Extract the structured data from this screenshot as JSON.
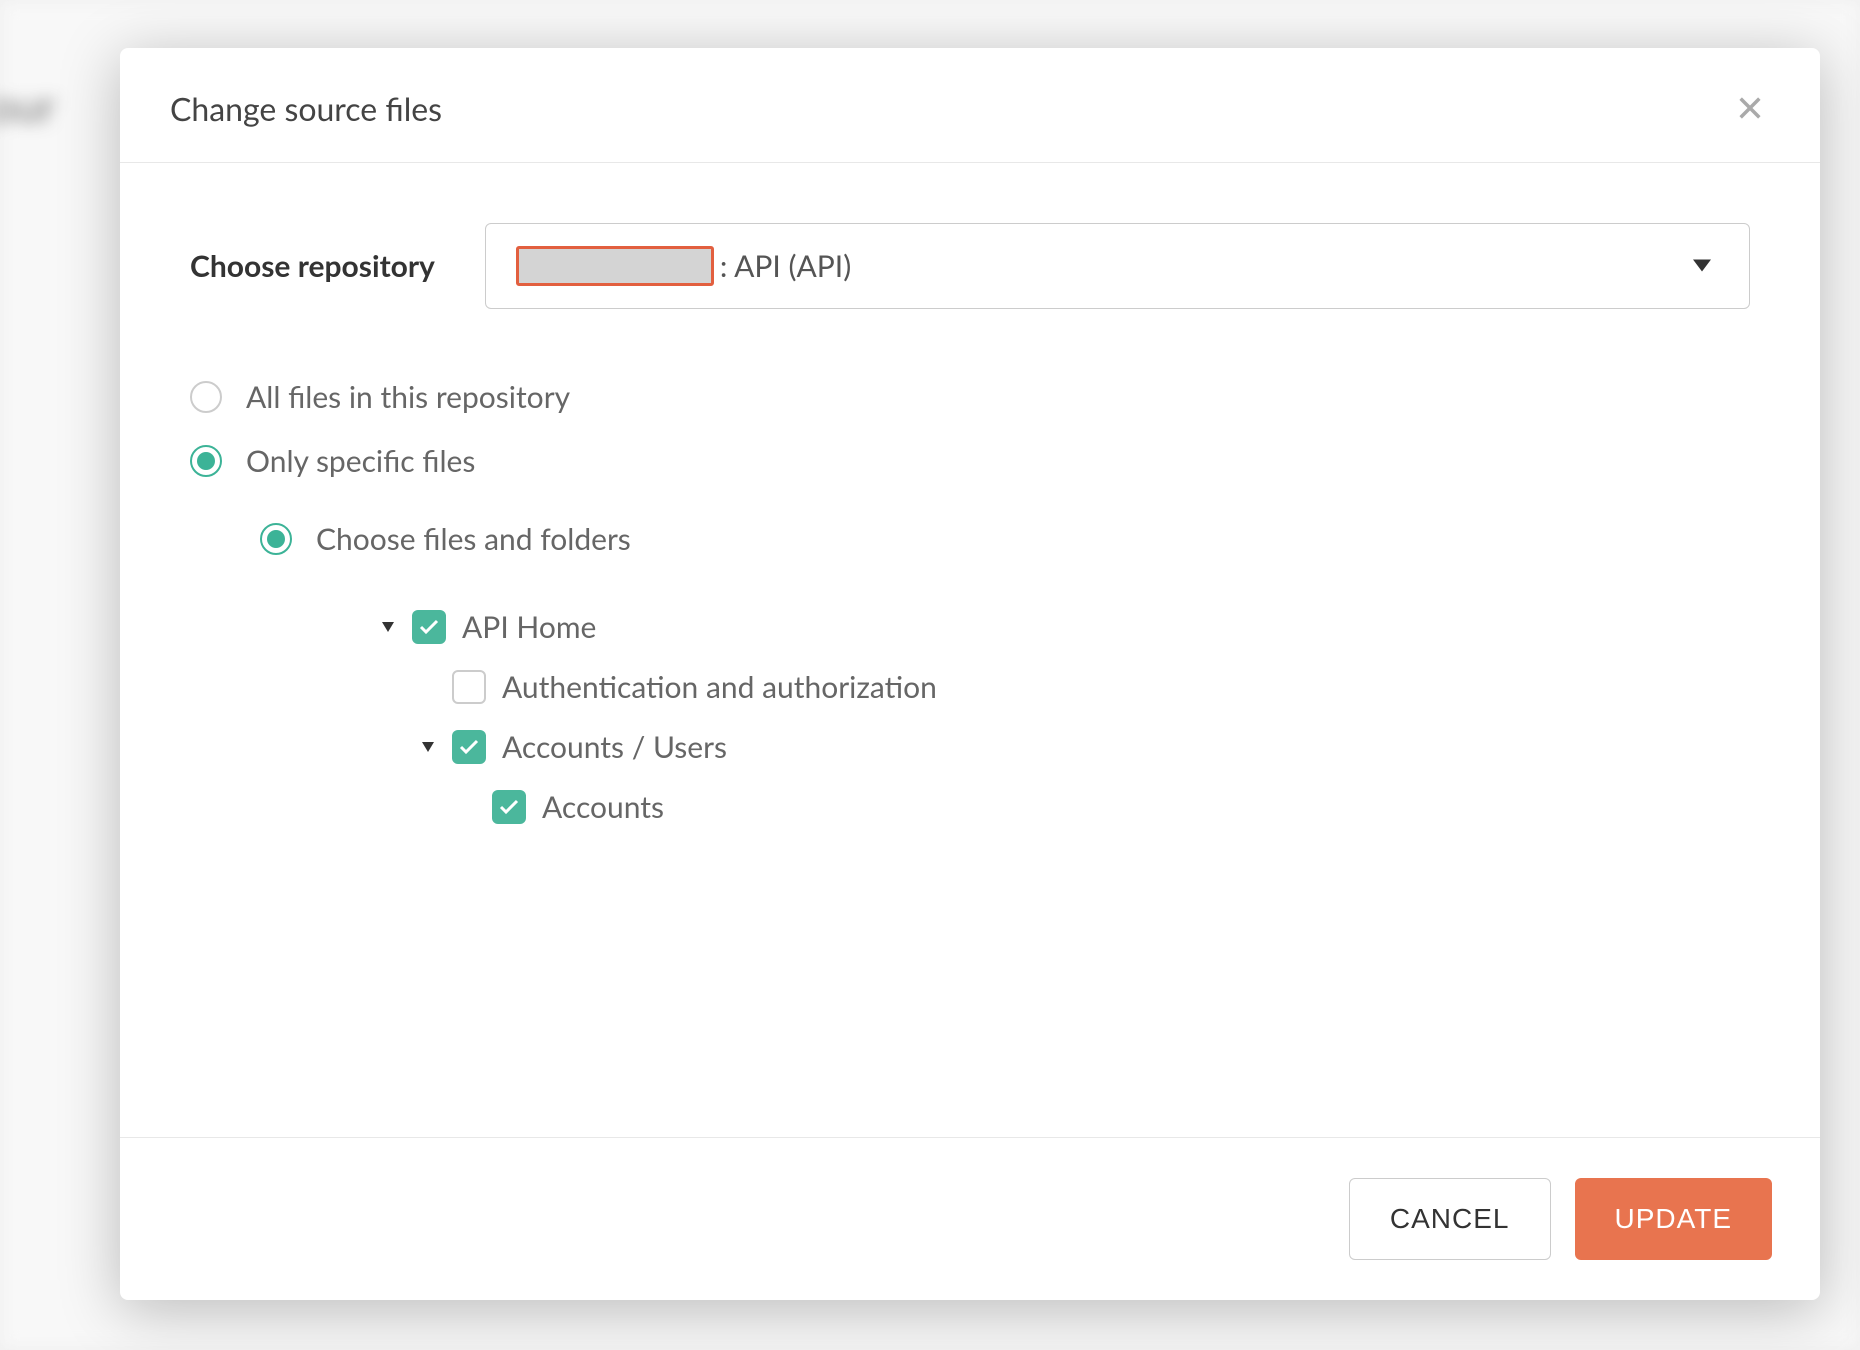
{
  "modal": {
    "title": "Change source files",
    "repo_label": "Choose repository",
    "repo_selected": ": API (API)",
    "radio_all": "All files in this repository",
    "radio_specific": "Only specific files",
    "radio_choose": "Choose files and folders",
    "tree": {
      "root": "API Home",
      "auth": "Authentication and authorization",
      "accounts_users": "Accounts / Users",
      "accounts": "Accounts"
    },
    "cancel": "CANCEL",
    "update": "UPDATE"
  },
  "background": {
    "text1": "our"
  }
}
